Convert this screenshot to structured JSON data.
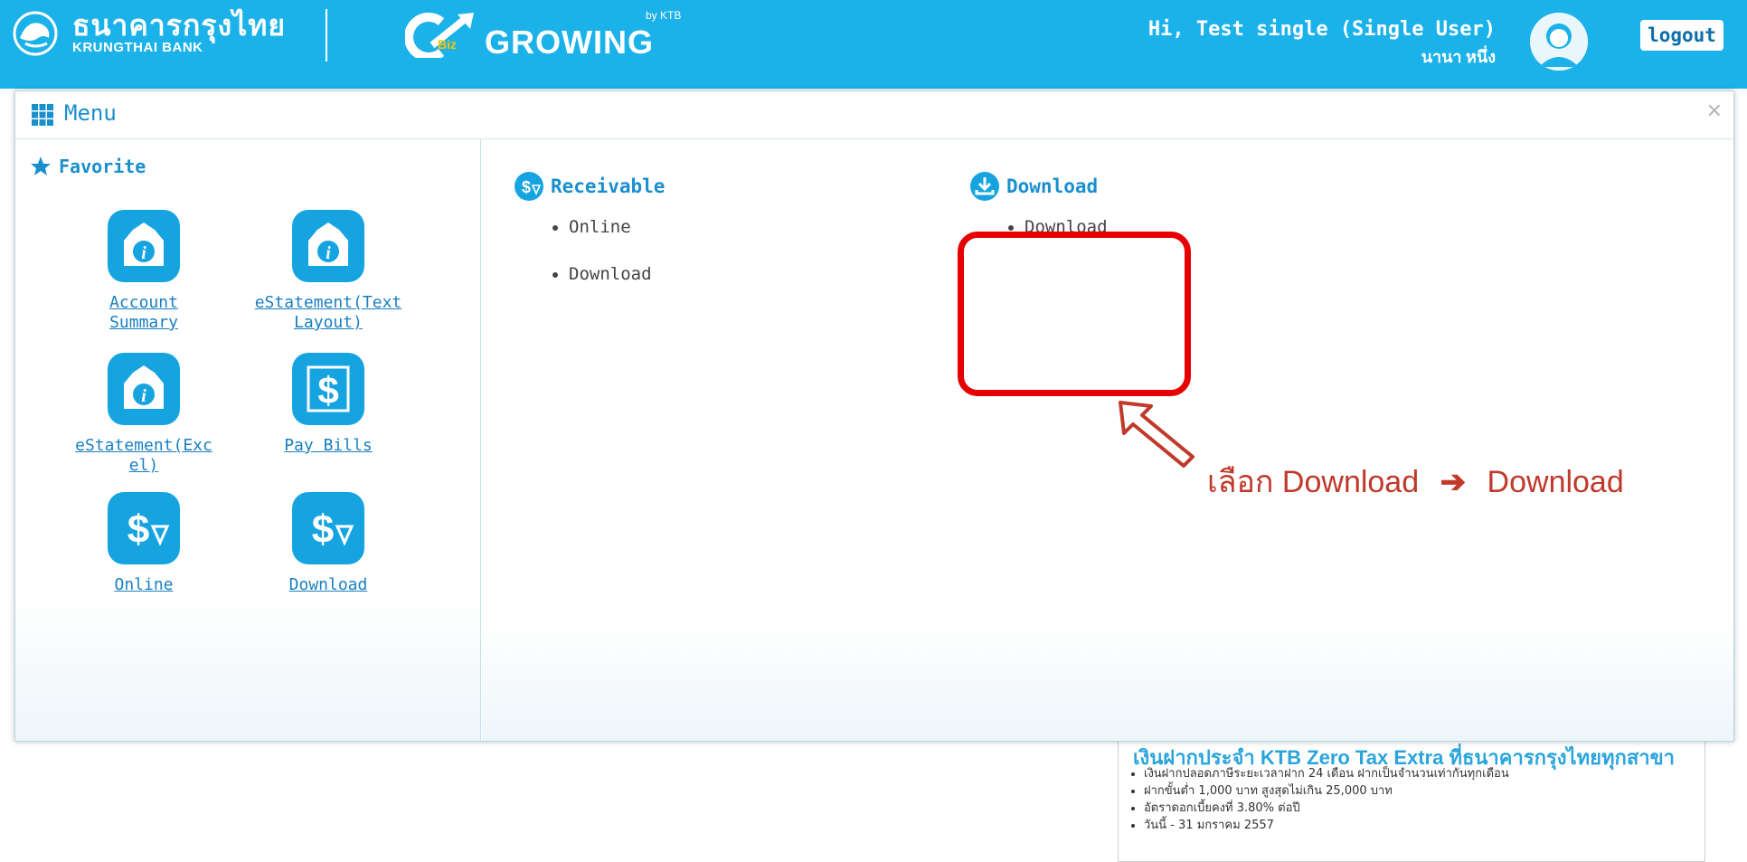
{
  "header": {
    "bank_name_th": "ธนาคารกรุงไทย",
    "bank_name_en": "KRUNGTHAI BANK",
    "brand_tag": "Biz",
    "brand_word": "GROWING",
    "brand_by": "by KTB",
    "greeting": "Hi, Test single (Single User)",
    "user_thai_name": "นานา หนึ่ง",
    "logout_label": "logout",
    "bg_color": "#1bb2ea"
  },
  "menu": {
    "title": "Menu",
    "close_icon": "close-icon",
    "favorite": {
      "label": "Favorite",
      "items": [
        {
          "label": "Account Summary",
          "icon": "info-document-icon"
        },
        {
          "label": "eStatement(Text Layout)",
          "icon": "info-document-icon"
        },
        {
          "label": "eStatement(Excel)",
          "icon": "info-document-icon"
        },
        {
          "label": "Pay Bills",
          "icon": "dollar-bill-icon"
        },
        {
          "label": "Online",
          "icon": "dollar-receive-icon"
        },
        {
          "label": "Download",
          "icon": "dollar-receive-icon"
        }
      ]
    },
    "categories": [
      {
        "title": "Receivable",
        "icon": "dollar-receive-icon",
        "items": [
          "Online",
          "Download"
        ]
      },
      {
        "title": "Download",
        "icon": "download-icon",
        "items": [
          "Download"
        ]
      }
    ]
  },
  "annotation": {
    "text_select": "เลือก",
    "step1": "Download",
    "arrow": "➔",
    "step2": "Download",
    "color": "#c0392b"
  },
  "promo": {
    "title": "เงินฝากประจำ KTB Zero Tax Extra ที่ธนาคารกรุงไทยทุกสาขา",
    "bullets": [
      "เงินฝากปลอดภาษีระยะเวลาฝาก 24 เดือน ฝากเป็นจำนวนเท่ากันทุกเดือน",
      "ฝากขั้นต่ำ 1,000 บาท สูงสุดไม่เกิน 25,000 บาท",
      "อัตราดอกเบี้ยคงที่ 3.80% ต่อปี",
      "วันนี้ - 31 มกราคม 2557"
    ]
  }
}
